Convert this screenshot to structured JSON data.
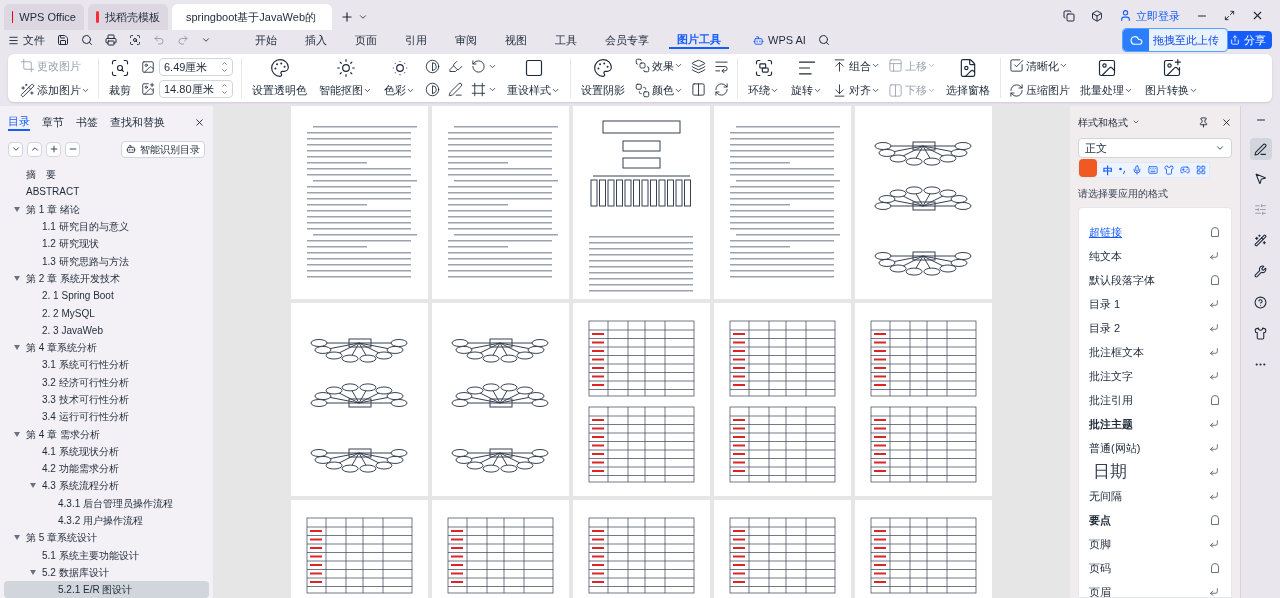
{
  "window": {
    "tabs": [
      {
        "label": "WPS Office",
        "kind": "wps",
        "selected": false
      },
      {
        "label": "找稻壳模板",
        "kind": "docer",
        "selected": false
      },
      {
        "label": "springboot基于JavaWeb的",
        "kind": "doc",
        "selected": true
      }
    ],
    "login": "立即登录"
  },
  "menu": {
    "file": "文件",
    "items": [
      {
        "label": "开始",
        "selected": false
      },
      {
        "label": "插入",
        "selected": false
      },
      {
        "label": "页面",
        "selected": false
      },
      {
        "label": "引用",
        "selected": false
      },
      {
        "label": "审阅",
        "selected": false
      },
      {
        "label": "视图",
        "selected": false
      },
      {
        "label": "工具",
        "selected": false
      },
      {
        "label": "会员专享",
        "selected": false
      },
      {
        "label": "图片工具",
        "selected": true
      }
    ],
    "ai": "WPS AI",
    "upload_tip": "拖拽至此上传",
    "share": "分享"
  },
  "ribbon": {
    "groups": [
      {
        "columns": [
          {
            "kind": "small",
            "items": [
              {
                "label": "更改图片",
                "disabled": true,
                "dropdown": false
              },
              {
                "label": "添加图片",
                "disabled": false,
                "dropdown": true
              }
            ]
          }
        ]
      },
      {
        "columns": [
          {
            "kind": "large",
            "items": [
              {
                "label": "裁剪",
                "disabled": false,
                "dropdown": false
              }
            ]
          },
          {
            "kind": "size",
            "fields": [
              {
                "value": "6.49厘米"
              },
              {
                "value": "14.80厘米"
              }
            ]
          }
        ]
      },
      {
        "columns": [
          {
            "kind": "large",
            "items": [
              {
                "label": "设置透明色",
                "disabled": false,
                "dropdown": false
              }
            ]
          },
          {
            "kind": "large",
            "items": [
              {
                "label": "智能抠图",
                "disabled": false,
                "dropdown": true
              }
            ]
          },
          {
            "kind": "large",
            "items": [
              {
                "label": "色彩",
                "disabled": false,
                "dropdown": true
              }
            ]
          },
          {
            "kind": "small",
            "items": [
              {
                "disabled": false,
                "dropdown": false
              },
              {
                "disabled": false,
                "dropdown": false
              }
            ]
          },
          {
            "kind": "small",
            "items": [
              {
                "disabled": false,
                "dropdown": false
              },
              {
                "disabled": false,
                "dropdown": false
              }
            ]
          },
          {
            "kind": "small",
            "items": [
              {
                "disabled": false,
                "dropdown": true
              },
              {
                "disabled": false,
                "dropdown": true
              }
            ]
          },
          {
            "kind": "large",
            "items": [
              {
                "label": "重设样式",
                "disabled": false,
                "dropdown": true
              }
            ]
          }
        ]
      },
      {
        "columns": [
          {
            "kind": "large",
            "items": [
              {
                "label": "设置阴影",
                "disabled": false,
                "dropdown": false
              }
            ]
          },
          {
            "kind": "small",
            "items": [
              {
                "label": "效果",
                "disabled": false,
                "dropdown": true
              },
              {
                "label": "颜色",
                "disabled": false,
                "dropdown": true
              }
            ]
          },
          {
            "kind": "small",
            "items": [
              {
                "disabled": false,
                "dropdown": false
              },
              {
                "disabled": false,
                "dropdown": false
              }
            ]
          },
          {
            "kind": "small",
            "items": [
              {
                "disabled": false,
                "dropdown": false
              },
              {
                "disabled": false,
                "dropdown": false
              }
            ]
          }
        ]
      },
      {
        "columns": [
          {
            "kind": "large",
            "items": [
              {
                "label": "环绕",
                "disabled": false,
                "dropdown": true
              }
            ]
          },
          {
            "kind": "large",
            "items": [
              {
                "label": "旋转",
                "disabled": false,
                "dropdown": true
              }
            ]
          },
          {
            "kind": "small",
            "items": [
              {
                "label": "组合",
                "disabled": false,
                "dropdown": true
              },
              {
                "label": "对齐",
                "disabled": false,
                "dropdown": true
              }
            ]
          },
          {
            "kind": "small",
            "items": [
              {
                "label": "上移",
                "disabled": true,
                "dropdown": true
              },
              {
                "label": "下移",
                "disabled": true,
                "dropdown": true
              }
            ]
          },
          {
            "kind": "large",
            "items": [
              {
                "label": "选择窗格",
                "disabled": false,
                "dropdown": false
              }
            ]
          }
        ]
      },
      {
        "columns": [
          {
            "kind": "small",
            "items": [
              {
                "label": "清晰化",
                "disabled": false,
                "dropdown": true
              },
              {
                "label": "压缩图片",
                "disabled": false,
                "dropdown": false
              }
            ]
          },
          {
            "kind": "large",
            "items": [
              {
                "label": "批量处理",
                "disabled": false,
                "dropdown": true
              }
            ]
          },
          {
            "kind": "large",
            "items": [
              {
                "label": "图片转换",
                "disabled": false,
                "dropdown": true
              }
            ]
          }
        ]
      }
    ]
  },
  "sidebar": {
    "tabs": [
      {
        "label": "目录",
        "selected": true
      },
      {
        "label": "章节",
        "selected": false
      },
      {
        "label": "书签",
        "selected": false
      },
      {
        "label": "查找和替换",
        "selected": false
      }
    ],
    "smart_button": "智能识别目录",
    "toc": [
      {
        "label": "摘　要",
        "selected": false
      },
      {
        "label": "ABSTRACT",
        "selected": false
      },
      {
        "label": "第 1 章  绪论",
        "selected": false,
        "expanded": true,
        "children": [
          {
            "label": "1.1  研究目的与意义",
            "selected": false
          },
          {
            "label": "1.2  研究现状",
            "selected": false
          },
          {
            "label": "1.3  研究思路与方法",
            "selected": false
          }
        ]
      },
      {
        "label": "第 2 章  系统开发技术",
        "selected": false,
        "expanded": true,
        "children": [
          {
            "label": "2. 1 Spring Boot",
            "selected": false
          },
          {
            "label": "2. 2 MySQL",
            "selected": false
          },
          {
            "label": "2. 3 JavaWeb",
            "selected": false
          }
        ]
      },
      {
        "label": "第 4 章系统分析",
        "selected": false,
        "expanded": true,
        "children": [
          {
            "label": "3.1  系统可行性分析",
            "selected": false
          },
          {
            "label": "3.2  经济可行性分析",
            "selected": false
          },
          {
            "label": "3.3  技术可行性分析",
            "selected": false
          },
          {
            "label": "3.4  运行可行性分析",
            "selected": false
          }
        ]
      },
      {
        "label": "第 4 章  需求分析",
        "selected": false,
        "expanded": true,
        "children": [
          {
            "label": "4.1  系统现状分析",
            "selected": false
          },
          {
            "label": "4.2  功能需求分析",
            "selected": false
          },
          {
            "label": "4.3  系统流程分析",
            "selected": false,
            "expanded": true,
            "children": [
              {
                "label": "4.3.1 后台管理员操作流程",
                "selected": false
              },
              {
                "label": "4.3.2 用户操作流程",
                "selected": false
              }
            ]
          }
        ]
      },
      {
        "label": "第 5 章系统设计",
        "selected": false,
        "expanded": true,
        "children": [
          {
            "label": "5.1  系统主要功能设计",
            "selected": false
          },
          {
            "label": "5.2  数据库设计",
            "selected": false,
            "expanded": true,
            "children": [
              {
                "label": "5.2.1 E/R 图设计",
                "selected": true
              }
            ]
          }
        ]
      }
    ]
  },
  "pages": [
    {
      "kind": "text"
    },
    {
      "kind": "text"
    },
    {
      "kind": "flowchart"
    },
    {
      "kind": "text"
    },
    {
      "kind": "tree"
    },
    {
      "kind": "tree"
    },
    {
      "kind": "tree"
    },
    {
      "kind": "table"
    },
    {
      "kind": "table"
    },
    {
      "kind": "table"
    },
    {
      "kind": "table"
    },
    {
      "kind": "table"
    },
    {
      "kind": "table"
    },
    {
      "kind": "table"
    },
    {
      "kind": "table"
    }
  ],
  "styles_panel": {
    "title": "样式和格式",
    "current": "正文",
    "ime": {
      "label": "中"
    },
    "hint": "请选择要应用的格式",
    "styles": [
      {
        "label": "超链接",
        "kind": "character",
        "link": true,
        "bold": false,
        "large": false
      },
      {
        "label": "纯文本",
        "kind": "paragraph",
        "link": false,
        "bold": false,
        "large": false
      },
      {
        "label": "默认段落字体",
        "kind": "character",
        "link": false,
        "bold": false,
        "large": false
      },
      {
        "label": "目录 1",
        "kind": "paragraph",
        "link": false,
        "bold": false,
        "large": false
      },
      {
        "label": "目录 2",
        "kind": "paragraph",
        "link": false,
        "bold": false,
        "large": false
      },
      {
        "label": "批注框文本",
        "kind": "paragraph",
        "link": false,
        "bold": false,
        "large": false
      },
      {
        "label": "批注文字",
        "kind": "paragraph",
        "link": false,
        "bold": false,
        "large": false
      },
      {
        "label": "批注引用",
        "kind": "character",
        "link": false,
        "bold": false,
        "large": false
      },
      {
        "label": "批注主题",
        "kind": "paragraph",
        "link": false,
        "bold": true,
        "large": false
      },
      {
        "label": "普通(网站)",
        "kind": "paragraph",
        "link": false,
        "bold": false,
        "large": false
      },
      {
        "label": "日期",
        "kind": "paragraph",
        "link": false,
        "bold": false,
        "large": true
      },
      {
        "label": "无间隔",
        "kind": "paragraph",
        "link": false,
        "bold": false,
        "large": false
      },
      {
        "label": "要点",
        "kind": "character",
        "link": false,
        "bold": true,
        "large": false
      },
      {
        "label": "页脚",
        "kind": "paragraph",
        "link": false,
        "bold": false,
        "large": false
      },
      {
        "label": "页码",
        "kind": "character",
        "link": false,
        "bold": false,
        "large": false
      },
      {
        "label": "页眉",
        "kind": "paragraph",
        "link": false,
        "bold": false,
        "large": false
      }
    ]
  }
}
